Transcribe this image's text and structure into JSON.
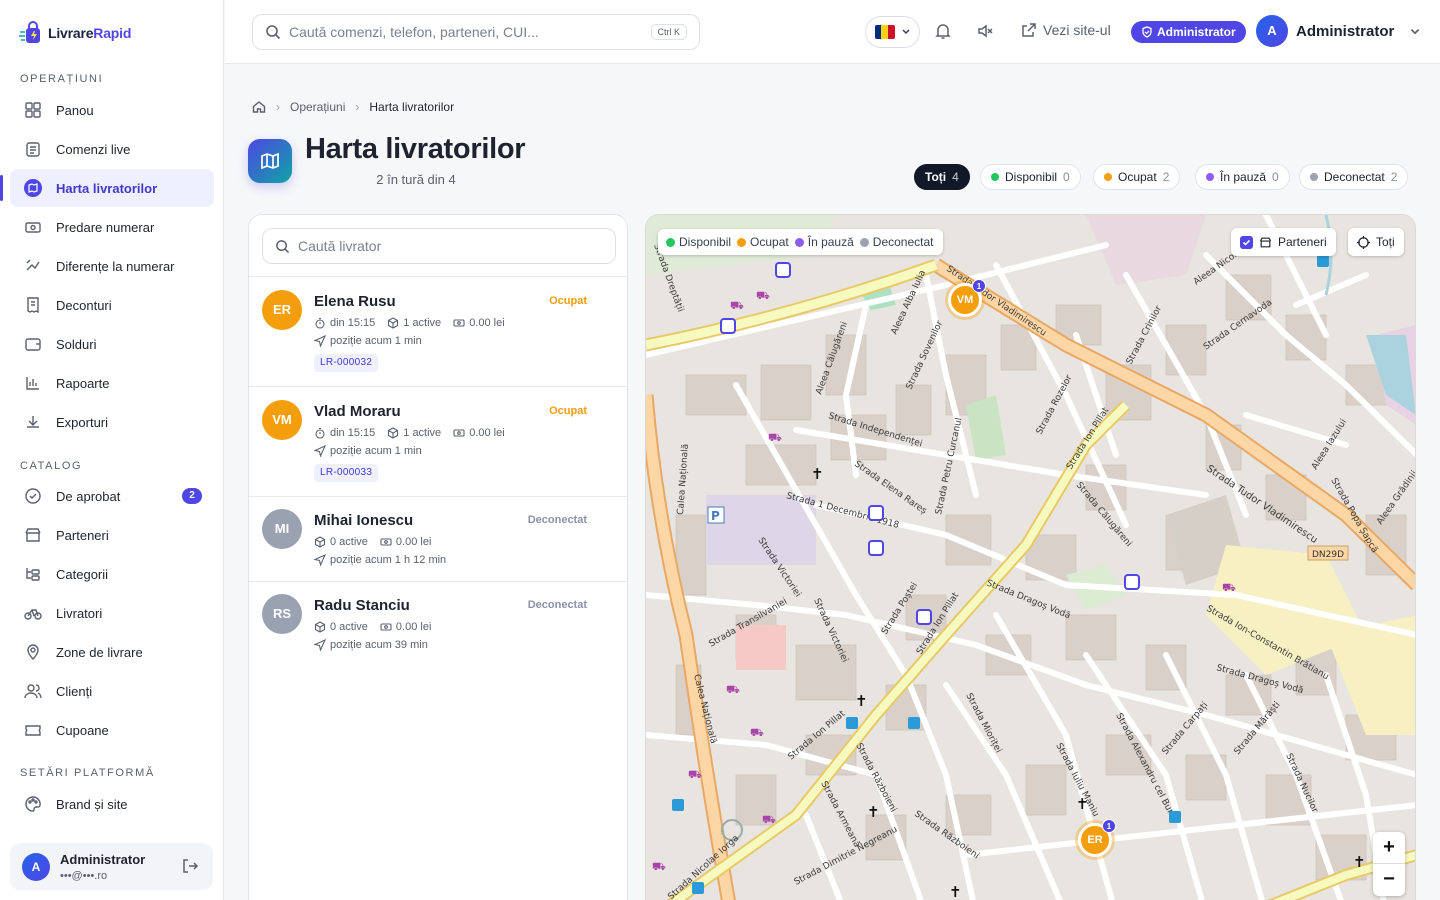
{
  "brand": {
    "name_a": "Livrare",
    "name_b": "Rapid"
  },
  "sidebar": {
    "section1": "OPERAȚIUNI",
    "section2": "CATALOG",
    "section3": "SETĂRI PLATFORMĂ",
    "items": [
      {
        "label": "Panou",
        "icon": "grid-icon"
      },
      {
        "label": "Comenzi live",
        "icon": "clipboard-icon"
      },
      {
        "label": "Harta livratorilor",
        "icon": "map-icon"
      },
      {
        "label": "Predare numerar",
        "icon": "cash-icon"
      },
      {
        "label": "Diferențe la numerar",
        "icon": "coins-icon"
      },
      {
        "label": "Deconturi",
        "icon": "receipt-icon"
      },
      {
        "label": "Solduri",
        "icon": "wallet-icon"
      },
      {
        "label": "Rapoarte",
        "icon": "bar-chart-icon"
      },
      {
        "label": "Exporturi",
        "icon": "download-icon"
      },
      {
        "label": "De aprobat",
        "icon": "check-circle-icon",
        "badge": "2"
      },
      {
        "label": "Parteneri",
        "icon": "store-icon"
      },
      {
        "label": "Categorii",
        "icon": "tree-icon"
      },
      {
        "label": "Livratori",
        "icon": "bike-icon"
      },
      {
        "label": "Zone de livrare",
        "icon": "pin-icon"
      },
      {
        "label": "Clienți",
        "icon": "users-icon"
      },
      {
        "label": "Cupoane",
        "icon": "ticket-icon"
      },
      {
        "label": "Brand și site",
        "icon": "palette-icon"
      }
    ],
    "user": {
      "avatar": "A",
      "name": "Administrator",
      "email": "•••@•••.ro"
    }
  },
  "topbar": {
    "search_placeholder": "Caută comenzi, telefon, parteneri, CUI...",
    "shortcut": "Ctrl K",
    "visit": "Vezi site-ul",
    "role": "Administrator",
    "avatar": "A",
    "user": "Administrator",
    "flag_colors": [
      "#002b7f",
      "#fcd116",
      "#ce1126"
    ]
  },
  "breadcrumb": {
    "parent": "Operațiuni",
    "current": "Harta livratorilor"
  },
  "page": {
    "title": "Harta livratorilor",
    "subtitle": "2 în tură din 4"
  },
  "filters": [
    {
      "label": "Toți",
      "count": "4",
      "color": ""
    },
    {
      "label": "Disponibil",
      "count": "0",
      "color": "#22c55e"
    },
    {
      "label": "Ocupat",
      "count": "2",
      "color": "#f59e0b"
    },
    {
      "label": "În pauză",
      "count": "0",
      "color": "#8b5cf6"
    },
    {
      "label": "Deconectat",
      "count": "2",
      "color": "#9ca3af"
    }
  ],
  "panel": {
    "search_placeholder": "Caută livrator"
  },
  "couriers": [
    {
      "initials": "ER",
      "name": "Elena Rusu",
      "status": "Ocupat",
      "status_color": "#f59e0b",
      "avatar_color": "#f59e0b",
      "since": "din 15:15",
      "active": "1 active",
      "cash": "0.00 lei",
      "pos": "poziție acum 1 min",
      "order": "LR-000032"
    },
    {
      "initials": "VM",
      "name": "Vlad Moraru",
      "status": "Ocupat",
      "status_color": "#f59e0b",
      "avatar_color": "#f59e0b",
      "since": "din 15:15",
      "active": "1 active",
      "cash": "0.00 lei",
      "pos": "poziție acum 1 min",
      "order": "LR-000033"
    },
    {
      "initials": "MI",
      "name": "Mihai Ionescu",
      "status": "Deconectat",
      "status_color": "#8a93a6",
      "avatar_color": "#9aa1b1",
      "active": "0 active",
      "cash": "0.00 lei",
      "pos": "poziție acum 1 h 12 min"
    },
    {
      "initials": "RS",
      "name": "Radu Stanciu",
      "status": "Deconectat",
      "status_color": "#8a93a6",
      "avatar_color": "#9aa1b1",
      "active": "0 active",
      "cash": "0.00 lei",
      "pos": "poziție acum 39 min"
    }
  ],
  "map": {
    "legend": [
      {
        "label": "Disponibil",
        "color": "#22c55e"
      },
      {
        "label": "Ocupat",
        "color": "#f59e0b"
      },
      {
        "label": "În pauză",
        "color": "#8b5cf6"
      },
      {
        "label": "Deconectat",
        "color": "#9ca3af"
      }
    ],
    "partners_toggle": "Parteneri",
    "all_button": "Toți",
    "zoom_in": "+",
    "zoom_out": "−",
    "markers": [
      {
        "initials": "VM",
        "count": "1"
      },
      {
        "initials": "ER",
        "count": "1"
      }
    ],
    "streets": [
      "Strada Tudor Vladimirescu",
      "Calea Națională",
      "Strada Ion Pillat",
      "Strada Independenței",
      "Strada Elena Rareș",
      "Strada 1 Decembrie 1918",
      "Strada Victoriei",
      "Strada Transilvaniei",
      "Strada Poștei",
      "Strada Dragoș Vodă",
      "Strada Ion-Constantin Brătianu",
      "Strada Mioriței",
      "Strada Armeană",
      "Strada Războieni",
      "Strada Dimitrie Negreanu",
      "Strada Nicolae Iorga",
      "Strada Iuliu Maniu",
      "Strada Alexandru cel Bun",
      "Strada Carpați",
      "Strada Mărăști",
      "Strada Nucilor",
      "Strada Călugăreni",
      "Strada Rozelor",
      "Strada Crinilor",
      "Strada Cernavoda",
      "Aleea Nicolae",
      "Aleea Iazului",
      "Strada Popa Șapcă",
      "Aleea Grădinii",
      "Strada Petru Curcanul",
      "Strada Sovenilor",
      "Aleea Alba Iulia",
      "Aleea Călugăreni",
      "Strada Dreptății",
      "DN29D"
    ]
  }
}
